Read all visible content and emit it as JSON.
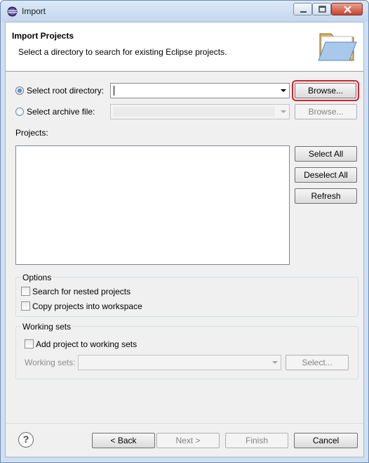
{
  "window": {
    "title": "Import"
  },
  "header": {
    "title": "Import Projects",
    "description": "Select a directory to search for existing Eclipse projects."
  },
  "source": {
    "root_label": "Select root directory:",
    "root_value": "",
    "root_selected": true,
    "archive_label": "Select archive file:",
    "archive_value": "",
    "browse_label": "Browse...",
    "browse_archive_label": "Browse..."
  },
  "projects": {
    "label": "Projects:",
    "items": [],
    "select_all": "Select All",
    "deselect_all": "Deselect All",
    "refresh": "Refresh"
  },
  "options": {
    "title": "Options",
    "nested_label": "Search for nested projects",
    "copy_label": "Copy projects into workspace"
  },
  "working_sets": {
    "title": "Working sets",
    "add_label": "Add project to working sets",
    "sets_label": "Working sets:",
    "select_label": "Select..."
  },
  "footer": {
    "back": "< Back",
    "next": "Next >",
    "finish": "Finish",
    "cancel": "Cancel"
  },
  "colors": {
    "highlight": "#d2232a",
    "title_bar": "#c4d7ee"
  }
}
